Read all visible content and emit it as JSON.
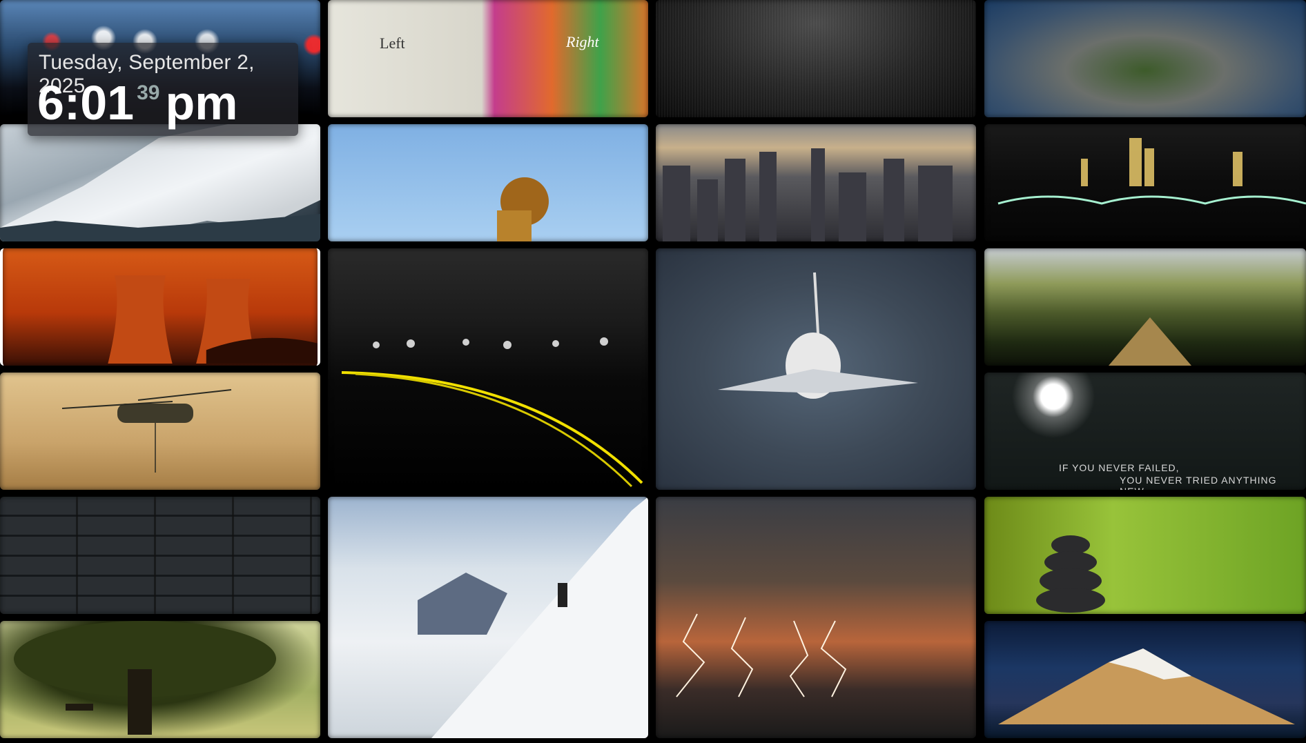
{
  "clock": {
    "date": "Tuesday, September 2, 2025",
    "time": "6:01",
    "seconds": "39",
    "ampm": "pm"
  },
  "wallpapers": {
    "left_right": {
      "left_label": "Left",
      "right_label": "Right"
    },
    "quote": {
      "line1": "IF YOU NEVER FAILED,",
      "line2": "YOU NEVER TRIED ANYTHING NEW."
    }
  },
  "tiles": [
    {
      "name": "blurred-city-lights-tile"
    },
    {
      "name": "left-right-brain-tile"
    },
    {
      "name": "dark-carbon-texture-tile"
    },
    {
      "name": "aerial-city-park-tile"
    },
    {
      "name": "snowy-mountain-tile"
    },
    {
      "name": "lion-sky-tile"
    },
    {
      "name": "new-york-skyline-tile"
    },
    {
      "name": "night-bridge-city-tile"
    },
    {
      "name": "cooling-towers-sunset-tile"
    },
    {
      "name": "night-road-light-trails-tile"
    },
    {
      "name": "space-shuttle-tile"
    },
    {
      "name": "lake-canoe-tile"
    },
    {
      "name": "helicopter-dust-tile"
    },
    {
      "name": "bokeh-quote-tile"
    },
    {
      "name": "stone-wall-tile"
    },
    {
      "name": "mountain-climber-tile"
    },
    {
      "name": "lightning-storm-tile"
    },
    {
      "name": "zen-stones-bamboo-tile"
    },
    {
      "name": "tree-sunlight-tile"
    },
    {
      "name": "volcano-night-sky-tile"
    }
  ]
}
